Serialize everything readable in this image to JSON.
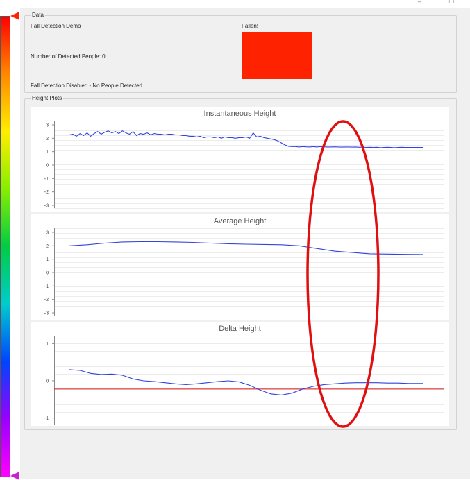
{
  "window": {
    "minimize_glyph": "–",
    "restore_glyph": "☐"
  },
  "data_group": {
    "title": "Data",
    "demo_label": "Fall Detection Demo",
    "people_count_label": "Number of Detected People: 0",
    "status_message": "Fall Detection Disabled - No People Detected",
    "fall_indicator_label": "Fallen!",
    "fall_indicator_color": "#ff2200"
  },
  "plots_group": {
    "title": "Height Plots"
  },
  "colorbar": {
    "colors": [
      "#ff0000",
      "#ff8800",
      "#ffee00",
      "#88ee00",
      "#00cc44",
      "#00cccc",
      "#0044ff",
      "#9900ff",
      "#ff00ff"
    ],
    "marker_color": "#ff2200",
    "bottom_marker_color": "#cc22cc"
  },
  "annotation": {
    "color": "#e01010"
  },
  "chart_data": [
    {
      "type": "line",
      "title": "Instantaneous Height",
      "ylim": [
        -3,
        3
      ],
      "yticks": [
        "3",
        "2",
        "1",
        "0",
        "-1",
        "-2",
        "-3"
      ],
      "ytick_values": [
        3,
        2,
        1,
        0,
        -1,
        -2,
        -3
      ],
      "color": "#3344dd",
      "x": [
        0,
        1,
        2,
        3,
        4,
        5,
        6,
        7,
        8,
        9,
        10,
        11,
        12,
        13,
        14,
        15,
        16,
        17,
        18,
        19,
        20,
        21,
        22,
        23,
        24,
        25,
        26,
        27,
        28,
        29,
        30,
        31,
        32,
        33,
        34,
        35,
        36,
        37,
        38,
        39,
        40,
        41,
        42,
        43,
        44,
        45,
        46,
        47,
        48,
        49,
        50,
        51,
        52,
        53,
        54,
        55,
        56,
        57,
        58,
        59,
        60,
        61,
        62,
        63,
        64,
        65,
        66,
        67,
        68,
        69,
        70,
        71,
        72,
        73,
        74,
        75,
        76,
        77,
        78,
        79,
        80,
        81,
        82,
        83,
        84,
        85,
        86,
        87,
        88,
        89,
        90,
        91,
        92,
        93,
        94,
        95,
        96,
        97,
        98,
        99,
        100
      ],
      "values": [
        2.25,
        2.3,
        2.15,
        2.35,
        2.2,
        2.4,
        2.15,
        2.35,
        2.5,
        2.3,
        2.45,
        2.55,
        2.4,
        2.5,
        2.35,
        2.55,
        2.4,
        2.3,
        2.5,
        2.2,
        2.35,
        2.3,
        2.4,
        2.25,
        2.35,
        2.3,
        2.3,
        2.25,
        2.3,
        2.3,
        2.25,
        2.25,
        2.2,
        2.2,
        2.15,
        2.15,
        2.1,
        2.15,
        2.05,
        2.1,
        2.1,
        2.05,
        2.1,
        2.0,
        2.1,
        2.05,
        2.05,
        2.0,
        2.05,
        2.05,
        2.1,
        2.0,
        2.4,
        2.1,
        2.15,
        2.05,
        2.0,
        1.95,
        1.9,
        1.8,
        1.65,
        1.5,
        1.4,
        1.38,
        1.38,
        1.35,
        1.38,
        1.36,
        1.35,
        1.38,
        1.35,
        1.38,
        1.36,
        1.35,
        1.35,
        1.36,
        1.35,
        1.34,
        1.35,
        1.35,
        1.34,
        1.35,
        1.33,
        1.34,
        1.32,
        1.33,
        1.32,
        1.33,
        1.3,
        1.32,
        1.33,
        1.32,
        1.3,
        1.32,
        1.33,
        1.32,
        1.32,
        1.32,
        1.32,
        1.32,
        1.32
      ],
      "xlim": [
        0,
        100
      ]
    },
    {
      "type": "line",
      "title": "Average Height",
      "ylim": [
        -3,
        3
      ],
      "yticks": [
        "3",
        "2",
        "1",
        "0",
        "-1",
        "-2",
        "-3"
      ],
      "ytick_values": [
        3,
        2,
        1,
        0,
        -1,
        -2,
        -3
      ],
      "color": "#3344dd",
      "x": [
        0,
        5,
        10,
        15,
        20,
        25,
        30,
        35,
        40,
        45,
        50,
        55,
        60,
        65,
        70,
        75,
        80,
        85,
        90,
        95,
        100
      ],
      "values": [
        2.0,
        2.08,
        2.2,
        2.28,
        2.3,
        2.3,
        2.28,
        2.25,
        2.2,
        2.15,
        2.12,
        2.1,
        2.08,
        2.0,
        1.8,
        1.6,
        1.5,
        1.4,
        1.38,
        1.36,
        1.35
      ],
      "xlim": [
        0,
        100
      ]
    },
    {
      "type": "line",
      "title": "Delta Height",
      "ylim": [
        -1.1,
        1.1
      ],
      "yticks": [
        "1",
        "0",
        "-1"
      ],
      "ytick_values": [
        1,
        0,
        -1
      ],
      "color": "#3344dd",
      "threshold": -0.22,
      "threshold_color": "#e03333",
      "x": [
        0,
        3,
        6,
        9,
        12,
        15,
        18,
        21,
        24,
        27,
        30,
        33,
        36,
        39,
        42,
        45,
        48,
        51,
        54,
        57,
        60,
        63,
        66,
        69,
        72,
        75,
        78,
        81,
        84,
        87,
        90,
        93,
        96,
        100
      ],
      "values": [
        0.3,
        0.28,
        0.2,
        0.17,
        0.18,
        0.15,
        0.05,
        0.0,
        -0.02,
        -0.05,
        -0.08,
        -0.1,
        -0.08,
        -0.05,
        -0.02,
        0.0,
        -0.03,
        -0.12,
        -0.25,
        -0.35,
        -0.38,
        -0.33,
        -0.22,
        -0.15,
        -0.1,
        -0.08,
        -0.06,
        -0.05,
        -0.05,
        -0.05,
        -0.06,
        -0.06,
        -0.07,
        -0.07
      ],
      "xlim": [
        0,
        100
      ]
    }
  ]
}
